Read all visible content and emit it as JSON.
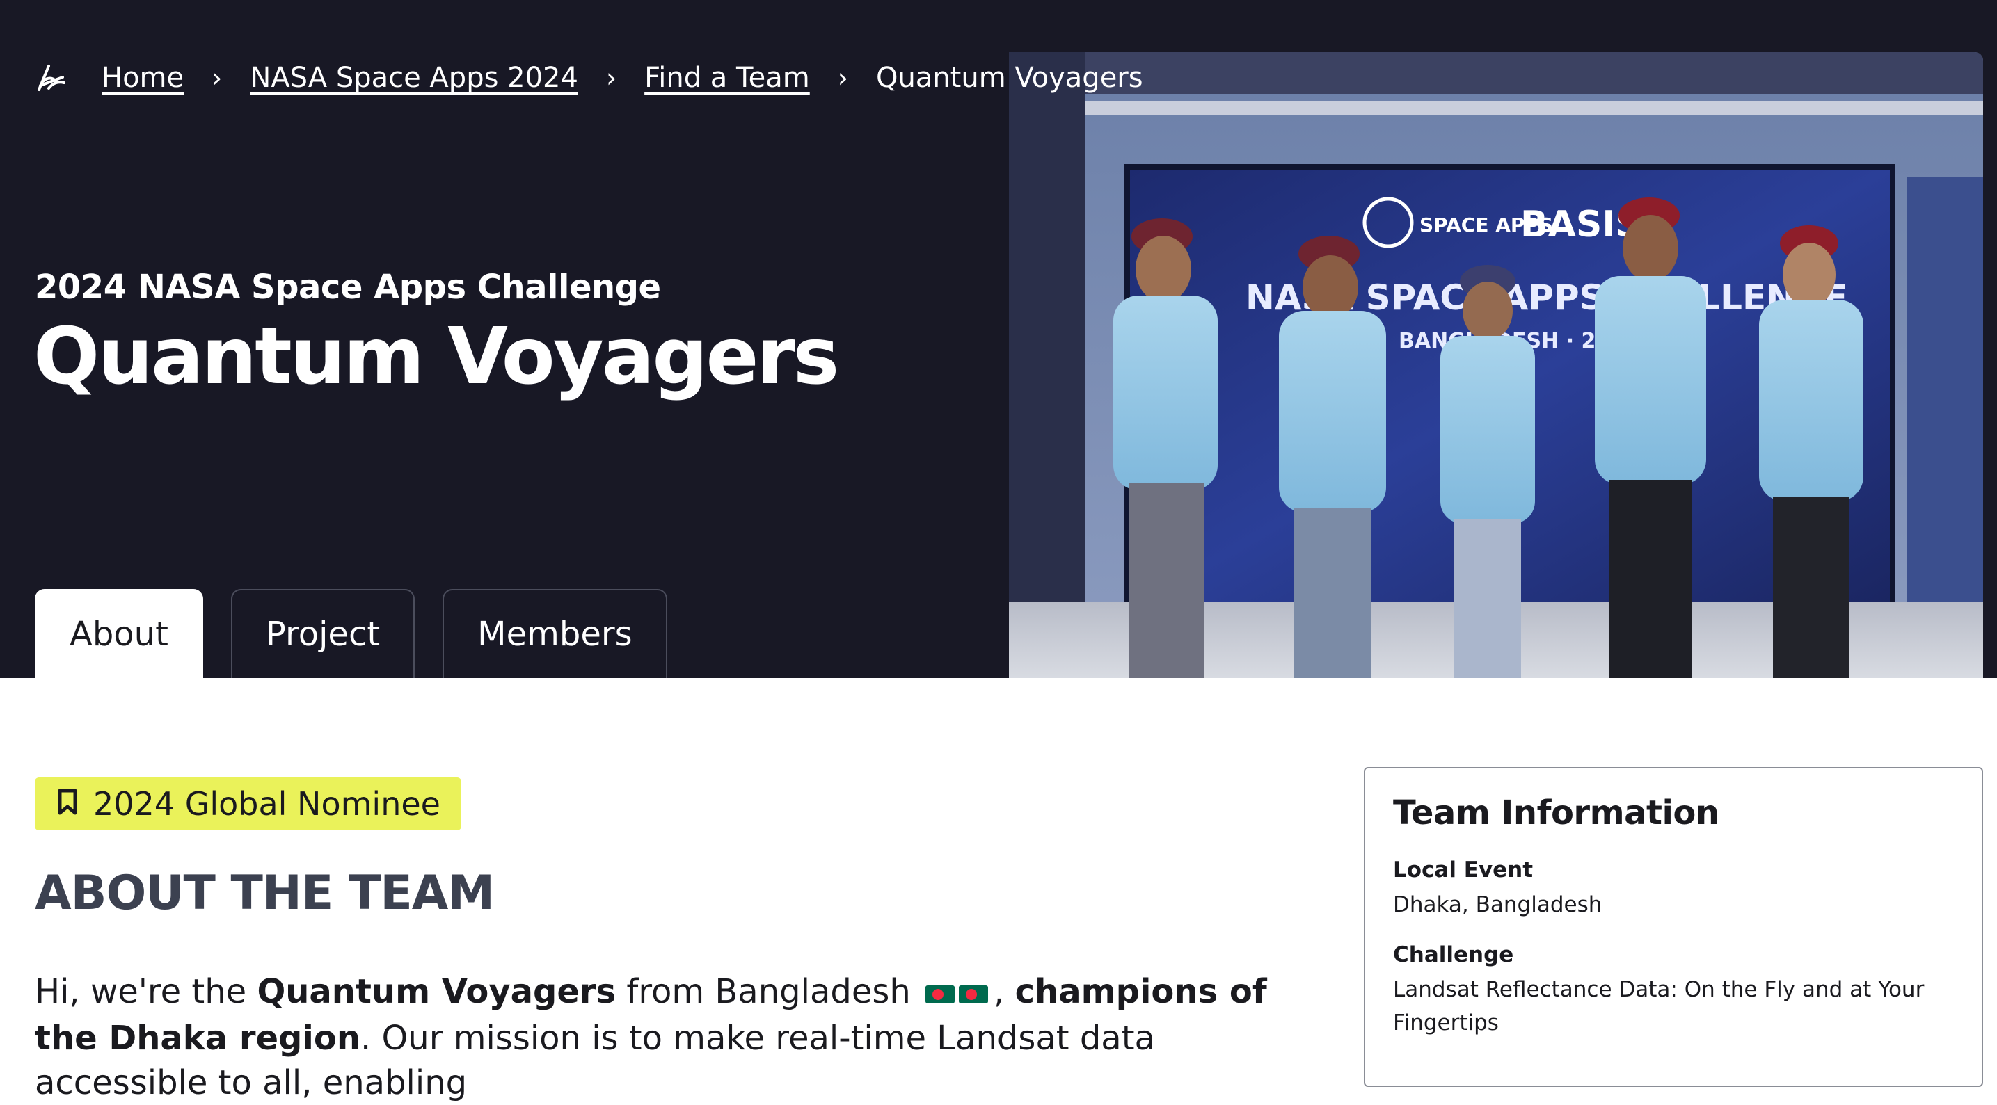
{
  "breadcrumb": {
    "items": [
      {
        "label": "Home"
      },
      {
        "label": "NASA Space Apps 2024"
      },
      {
        "label": "Find a Team"
      }
    ],
    "current": "Quantum Voyagers",
    "separator": "›"
  },
  "hero": {
    "event": "2024 NASA Space Apps Challenge",
    "title": "Quantum Voyagers",
    "photo": {
      "banner_text_1": "BASIS",
      "banner_text_2": "NASA SPACE APPS CHALLENGE",
      "banner_text_3": "BANGLADESH · 2024",
      "logo_text": "SPACE APPS"
    }
  },
  "tabs": [
    {
      "label": "About",
      "active": true
    },
    {
      "label": "Project",
      "active": false
    },
    {
      "label": "Members",
      "active": false
    }
  ],
  "badge": {
    "label": "2024 Global Nominee",
    "icon": "bookmark-icon",
    "color": "#eaf25a"
  },
  "about": {
    "heading": "ABOUT THE TEAM",
    "text_1": "Hi, we're the ",
    "team_name": "Quantum Voyagers",
    "text_2": " from Bangladesh ",
    "text_3": ", ",
    "champions": "champions of the Dhaka region",
    "text_4": ". Our mission is to make real-time Landsat data accessible to all, enabling"
  },
  "team_info": {
    "title": "Team Information",
    "local_event_label": "Local Event",
    "local_event_value": "Dhaka, Bangladesh",
    "challenge_label": "Challenge",
    "challenge_value": "Landsat Reflectance Data: On the Fly and at Your Fingertips"
  },
  "colors": {
    "hero_bg": "#181825",
    "badge_bg": "#eaf25a",
    "heading": "#3c4150",
    "flag_green": "#006a4e",
    "flag_red": "#f42a41"
  }
}
